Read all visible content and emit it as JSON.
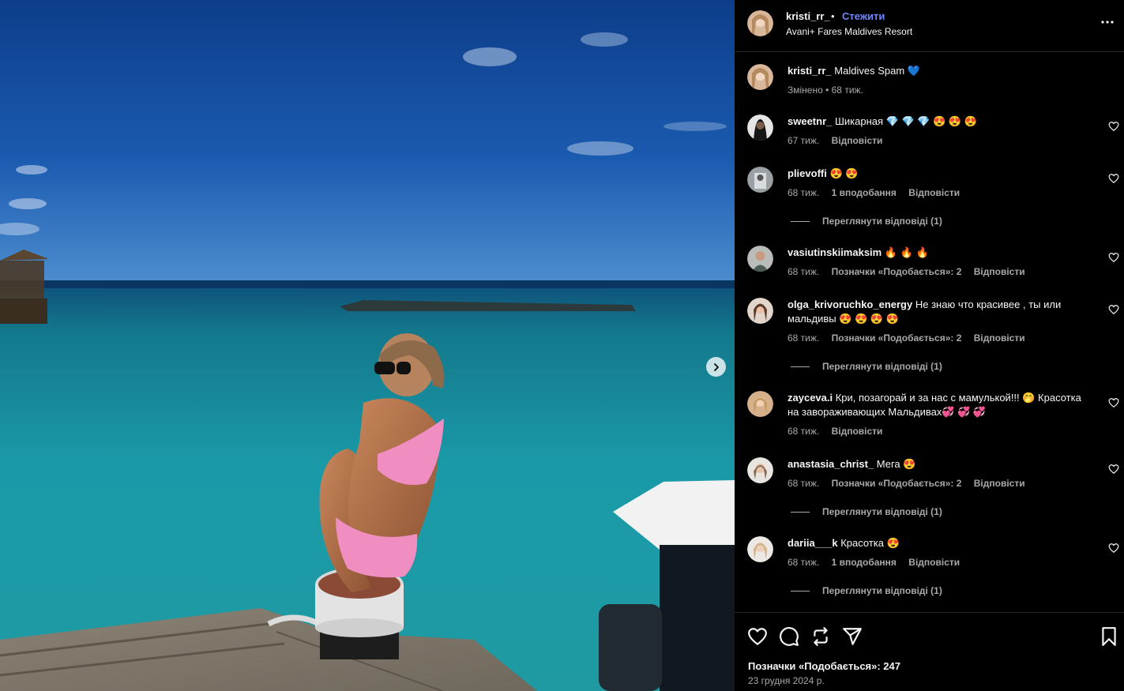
{
  "post": {
    "author": "kristi_rr_",
    "dot": "•",
    "follow_label": "Стежити",
    "location": "Avani+ Fares Maldives Resort",
    "more_label": "more-options",
    "caption_user": "kristi_rr_",
    "caption_text": "Maldives Spam 💙",
    "caption_meta": "Змінено • 68 тиж."
  },
  "comments": [
    {
      "user": "sweetnr_",
      "text": "Шикарная 💎 💎 💎 😍 😍 😍",
      "time": "67 тиж.",
      "likes": "",
      "reply": "Відповісти",
      "view_replies": ""
    },
    {
      "user": "plievoffi",
      "text": "😍 😍",
      "time": "68 тиж.",
      "likes": "1 вподобання",
      "reply": "Відповісти",
      "view_replies": "Переглянути відповіді (1)"
    },
    {
      "user": "vasiutinskiimaksim",
      "text": "🔥 🔥 🔥",
      "time": "68 тиж.",
      "likes": "Позначки «Подобається»: 2",
      "reply": "Відповісти",
      "view_replies": ""
    },
    {
      "user": "olga_krivoruchko_energy",
      "text": "Не знаю что красивее , ты или мальдивы 😍 😍 😍 😍",
      "time": "68 тиж.",
      "likes": "Позначки «Подобається»: 2",
      "reply": "Відповісти",
      "view_replies": "Переглянути відповіді (1)"
    },
    {
      "user": "zayceva.i",
      "text": "Кри, позагорай и за нас с мамулькой!!! 🤭 Красотка на завораживающих Мальдивах💞 💞 💞",
      "time": "68 тиж.",
      "likes": "",
      "reply": "Відповісти",
      "view_replies": ""
    },
    {
      "user": "anastasia_christ_",
      "text": "Мега 😍",
      "time": "68 тиж.",
      "likes": "Позначки «Подобається»: 2",
      "reply": "Відповісти",
      "view_replies": "Переглянути відповіді (1)"
    },
    {
      "user": "dariia___k",
      "text": "Красотка 😍",
      "time": "68 тиж.",
      "likes": "1 вподобання",
      "reply": "Відповісти",
      "view_replies": "Переглянути відповіді (1)"
    }
  ],
  "footer": {
    "likes": "Позначки «Подобається»: 247",
    "date": "23 грудня 2024 р."
  },
  "icons": {
    "like": "heart-icon",
    "comment": "comment-icon",
    "repost": "repost-icon",
    "share": "share-icon",
    "save": "bookmark-icon",
    "next": "chevron-right-icon"
  },
  "colors": {
    "follow": "#6e86ff",
    "muted": "#a8a8a8",
    "background": "#000000"
  }
}
